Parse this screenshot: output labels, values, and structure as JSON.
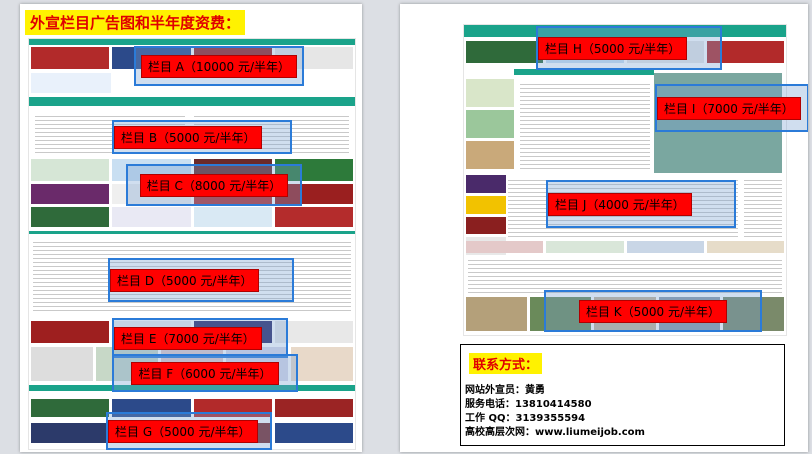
{
  "page1": {
    "heading": "外宣栏目广告图和半年度资费：",
    "ads": [
      {
        "label": "栏目 A（10000 元/半年）"
      },
      {
        "label": "栏目 B（5000 元/半年）"
      },
      {
        "label": "栏目 C（8000 元/半年）"
      },
      {
        "label": "栏目 D（5000 元/半年）"
      },
      {
        "label": "栏目 E（7000 元/半年）"
      },
      {
        "label": "栏目 F（6000 元/半年）"
      },
      {
        "label": "栏目 G（5000 元/半年）"
      }
    ]
  },
  "page2": {
    "ads": [
      {
        "label": "栏目 H（5000 元/半年）"
      },
      {
        "label": "栏目 I（7000 元/半年）"
      },
      {
        "label": "栏目 J（4000 元/半年）"
      },
      {
        "label": "栏目 K（5000 元/半年）"
      }
    ],
    "contact": {
      "heading": "联系方式：",
      "lines": [
        "网站外宣员：黄勇",
        "服务电话：13810414580",
        "工作 QQ：3139355594",
        "高校高层次网：www.liumeijob.com"
      ]
    }
  },
  "colors": {
    "accent": "#ff0000",
    "highlight": "#fff200",
    "frame": "#2b7bd8",
    "site_green": "#1aa38a"
  }
}
